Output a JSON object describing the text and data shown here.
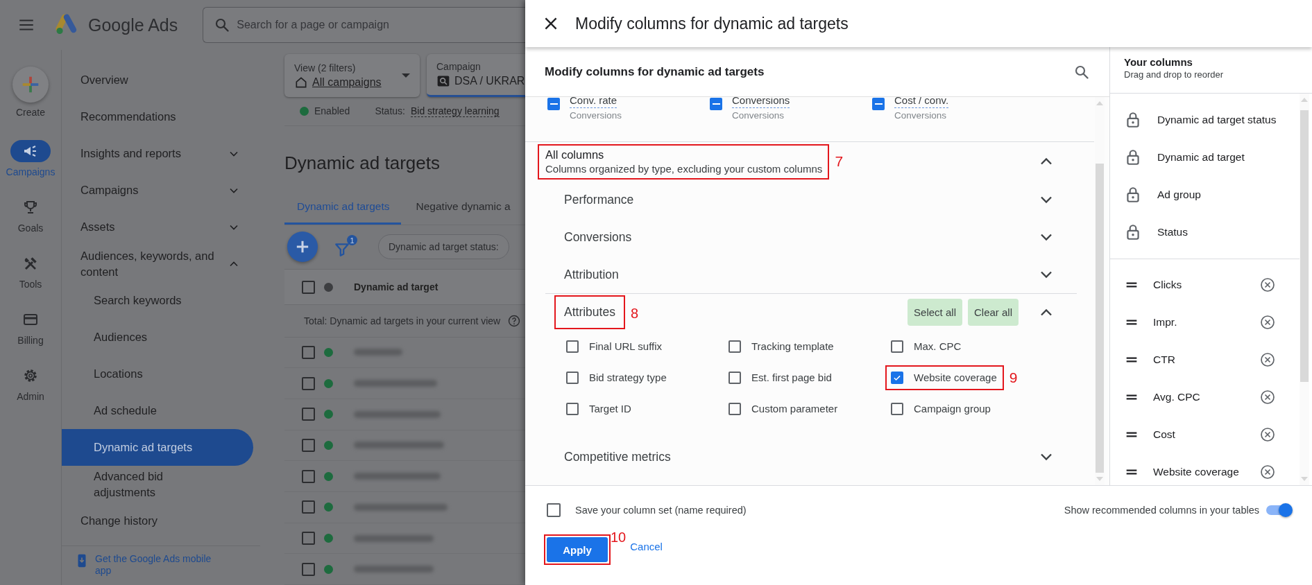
{
  "app_bar": {
    "product": "Google Ads",
    "search": {
      "placeholder": "Search for a page or campaign"
    }
  },
  "rail": [
    {
      "label": "Create",
      "kind": "create",
      "selected": false
    },
    {
      "label": "Campaigns",
      "kind": "nav",
      "selected": true
    },
    {
      "label": "Goals",
      "kind": "nav",
      "selected": false
    },
    {
      "label": "Tools",
      "kind": "nav",
      "selected": false
    },
    {
      "label": "Billing",
      "kind": "nav",
      "selected": false
    },
    {
      "label": "Admin",
      "kind": "nav",
      "selected": false
    }
  ],
  "sidebar": {
    "items": [
      {
        "label": "Overview",
        "selected": false
      },
      {
        "label": "Recommendations",
        "selected": false
      },
      {
        "label": "Insights and reports",
        "selected": false,
        "expanded": false
      },
      {
        "label": "Campaigns",
        "selected": false,
        "expanded": false
      },
      {
        "label": "Assets",
        "selected": false,
        "expanded": false
      },
      {
        "label": "Audiences, keywords, and content",
        "selected": false,
        "expanded": true,
        "children": [
          {
            "label": "Search keywords",
            "selected": false
          },
          {
            "label": "Audiences",
            "selected": false
          },
          {
            "label": "Locations",
            "selected": false
          },
          {
            "label": "Ad schedule",
            "selected": false
          },
          {
            "label": "Dynamic ad targets",
            "selected": true
          },
          {
            "label": "Advanced bid adjustments",
            "selected": false
          }
        ]
      },
      {
        "label": "Change history",
        "selected": false
      }
    ],
    "app_link": "Get the Google Ads mobile app"
  },
  "filters": [
    {
      "label": "View (2 filters)",
      "value": "All campaigns"
    },
    {
      "label": "Campaign",
      "value": "DSA / UKRAR"
    }
  ],
  "campaign_status": {
    "state": "Enabled",
    "label": "Status:",
    "value": "Bid strategy learning"
  },
  "page_title": "Dynamic ad targets",
  "tabs": [
    {
      "label": "Dynamic ad targets",
      "selected": true
    },
    {
      "label": "Negative dynamic a",
      "selected": false
    }
  ],
  "toolbar": {
    "filter_count": "1",
    "chip": "Dynamic ad target status:"
  },
  "table": {
    "header_checked": false,
    "columns": [
      "Dynamic ad target"
    ],
    "total": "Total: Dynamic ad targets in your current view",
    "rows": [
      {
        "checked": false
      },
      {
        "checked": false
      },
      {
        "checked": false
      },
      {
        "checked": false
      },
      {
        "checked": false
      },
      {
        "checked": false
      },
      {
        "checked": false
      },
      {
        "checked": false
      }
    ]
  },
  "dialog": {
    "title": "Modify columns for dynamic ad targets",
    "picker": {
      "heading": "Modify columns for dynamic ad targets",
      "selected_columns": [
        {
          "name": "Conv. rate",
          "category": "Conversions",
          "indeterminate": true
        },
        {
          "name": "Conversions",
          "category": "Conversions",
          "indeterminate": true
        },
        {
          "name": "Cost / conv.",
          "category": "Conversions",
          "indeterminate": true
        }
      ],
      "all_columns": {
        "title": "All columns",
        "subtitle": "Columns organized by type, excluding your custom columns",
        "expanded": true,
        "annotation": "7",
        "groups": [
          {
            "name": "Performance",
            "expanded": false
          },
          {
            "name": "Conversions",
            "expanded": false
          },
          {
            "name": "Attribution",
            "expanded": false
          },
          {
            "name": "Attributes",
            "expanded": true,
            "annotation": "8",
            "actions": [
              "Select all",
              "Clear all"
            ],
            "options": [
              {
                "label": "Final URL suffix",
                "checked": false
              },
              {
                "label": "Tracking template",
                "checked": false
              },
              {
                "label": "Max. CPC",
                "checked": false
              },
              {
                "label": "Bid strategy type",
                "checked": false
              },
              {
                "label": "Est. first page bid",
                "checked": false
              },
              {
                "label": "Website coverage",
                "checked": true,
                "annotation": "9"
              },
              {
                "label": "Target ID",
                "checked": false
              },
              {
                "label": "Custom parameter",
                "checked": false
              },
              {
                "label": "Campaign group",
                "checked": false
              }
            ]
          },
          {
            "name": "Competitive metrics",
            "expanded": false
          }
        ]
      }
    },
    "your_columns": {
      "title": "Your columns",
      "subtitle": "Drag and drop to reorder",
      "locked": [
        "Dynamic ad target status",
        "Dynamic ad target",
        "Ad group",
        "Status"
      ],
      "movable": [
        "Clicks",
        "Impr.",
        "CTR",
        "Avg. CPC",
        "Cost",
        "Website coverage"
      ]
    },
    "footer": {
      "save_set": {
        "label": "Save your column set (name required)",
        "checked": false
      },
      "recommended": {
        "label": "Show recommended columns in your tables",
        "on": true
      },
      "apply": {
        "label": "Apply",
        "annotation": "10"
      },
      "cancel": "Cancel"
    }
  }
}
